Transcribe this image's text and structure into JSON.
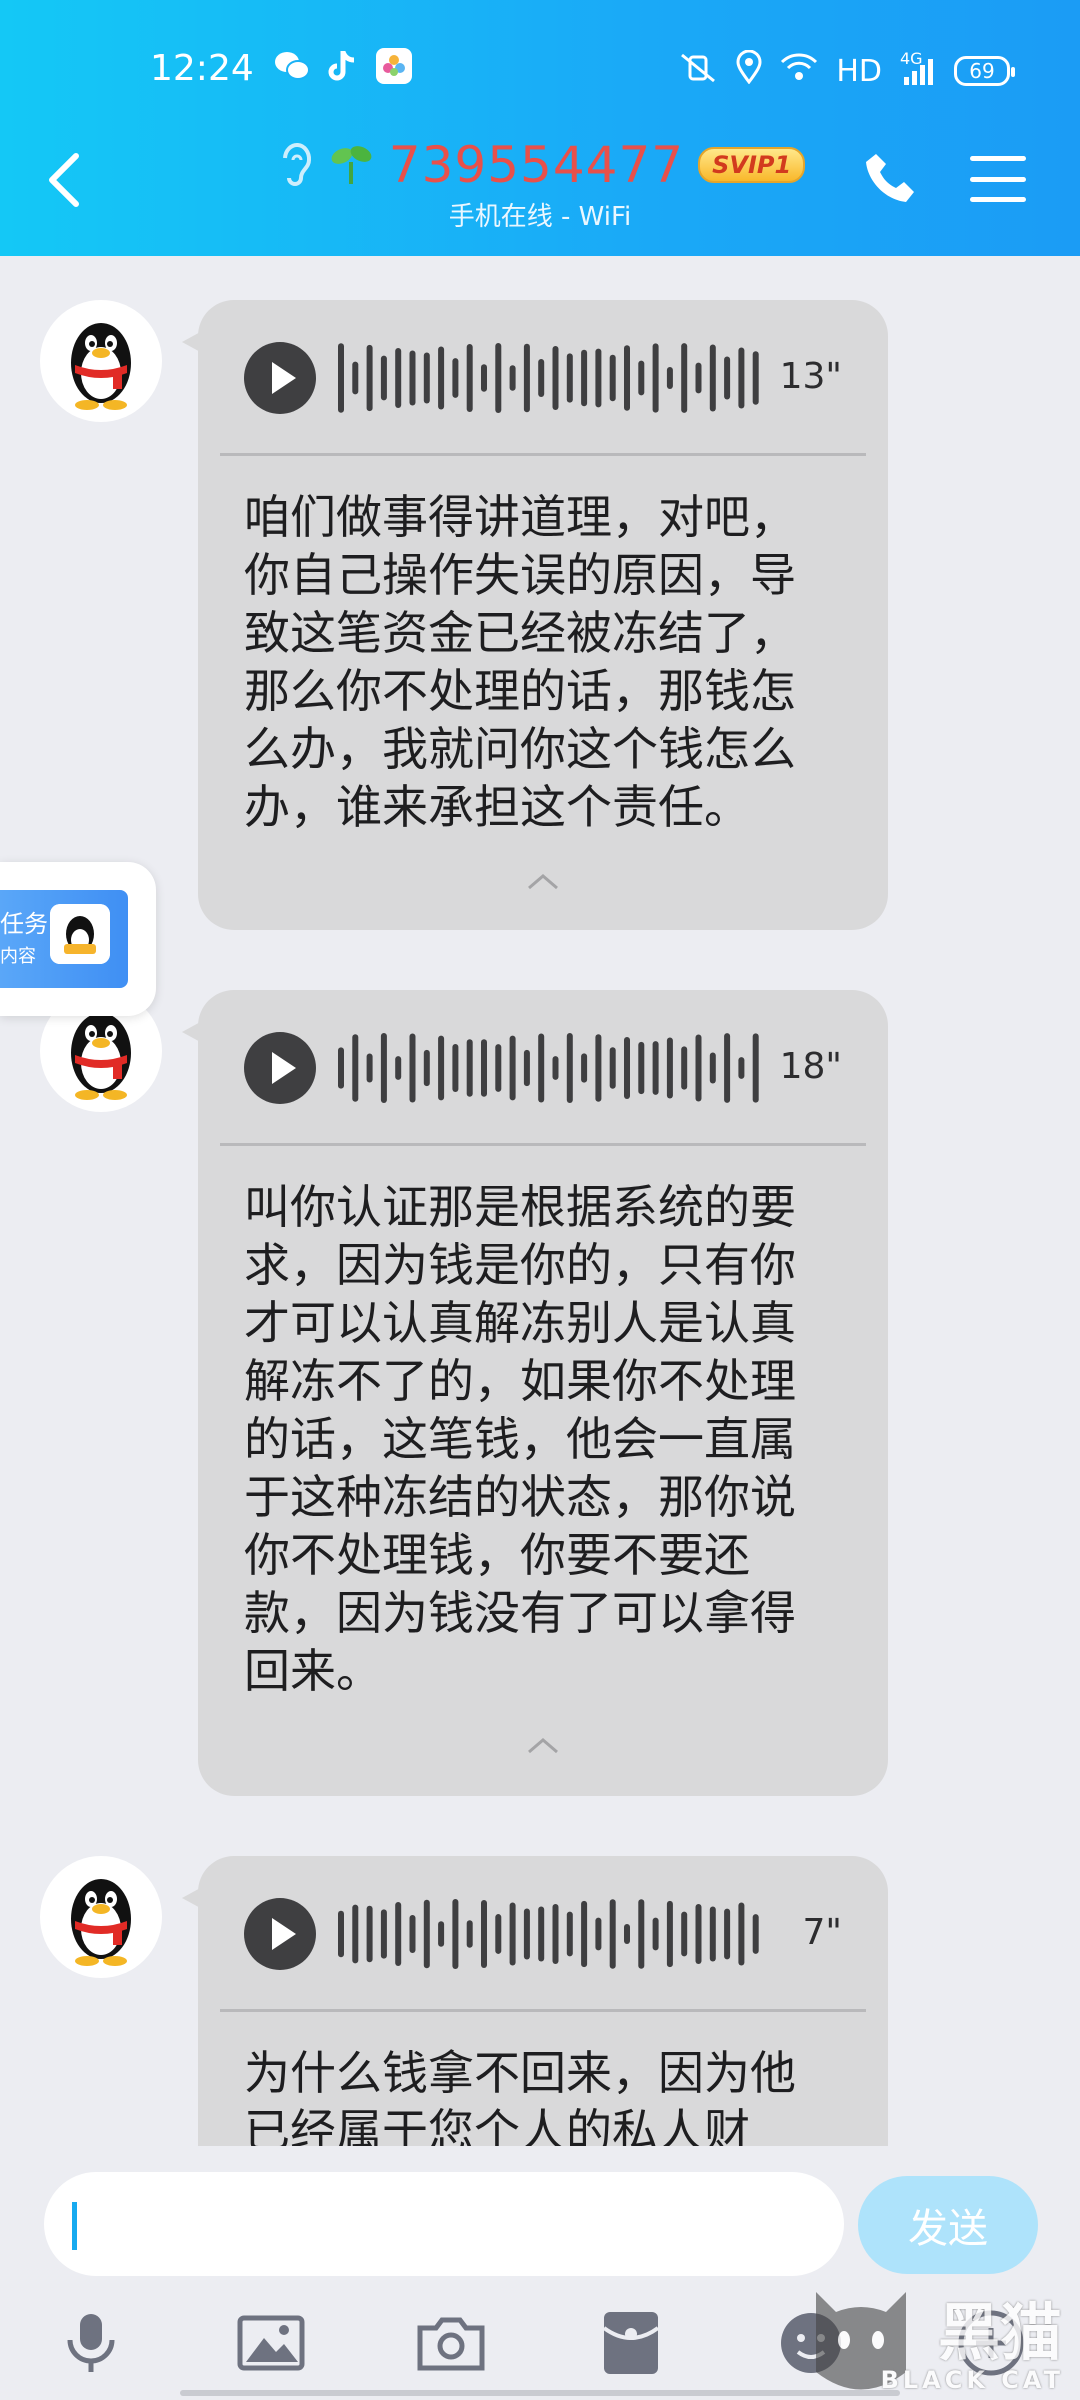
{
  "status_bar": {
    "time": "12:24",
    "network": "HD",
    "network_gen": "4G",
    "battery": "69"
  },
  "header": {
    "contact_number": "739554477",
    "vip_badge": "SVIP1",
    "subtitle": "手机在线 - WiFi"
  },
  "floating_task": {
    "line1": "任务",
    "line2": "内容"
  },
  "messages": [
    {
      "duration": "13\"",
      "transcript": "咱们做事得讲道理，对吧，你自己操作失误的原因，导致这笔资金已经被冻结了，那么你不处理的话，那钱怎么办，我就问你这个钱怎么办，谁来承担这个责任。"
    },
    {
      "duration": "18\"",
      "transcript": "叫你认证那是根据系统的要求，因为钱是你的，只有你才可以认真解冻别人是认真解冻不了的，如果你不处理的话，这笔钱，他会一直属于这种冻结的状态，那你说你不处理钱，你要不要还款，因为钱没有了可以拿得回来。"
    },
    {
      "duration": "7\"",
      "transcript": "为什么钱拿不回来，因为他已经属于您个人的私人财"
    }
  ],
  "input": {
    "value": "",
    "send_label": "发送"
  },
  "watermark": {
    "main": "黑猫",
    "sub": "BLACK CAT"
  },
  "colors": {
    "header_gradient_start": "#14c8f6",
    "header_gradient_end": "#1b9cf5",
    "contact_number": "#e8504a",
    "bubble": "#d9d9da",
    "chat_background": "#ecedf2",
    "send_button": "#aee3fb"
  }
}
